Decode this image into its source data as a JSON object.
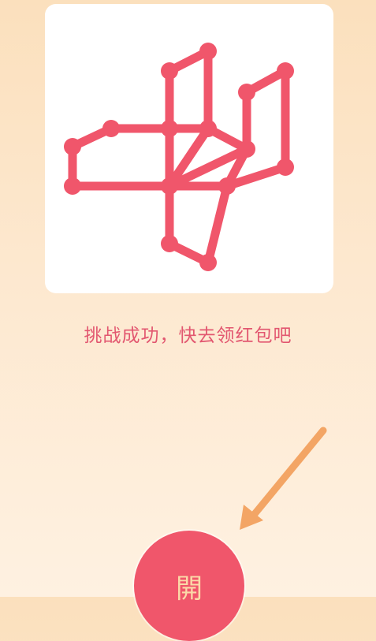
{
  "message": "挑战成功，快去领红包吧",
  "open_button": {
    "label": "開"
  },
  "colors": {
    "puzzle_line": "#f0566b",
    "message_text": "#e25770",
    "button": "#f0566b",
    "button_text": "#fbd9a8",
    "arrow": "#f3a565"
  },
  "icons": {
    "hint_arrow": "arrow-down-left-icon"
  }
}
